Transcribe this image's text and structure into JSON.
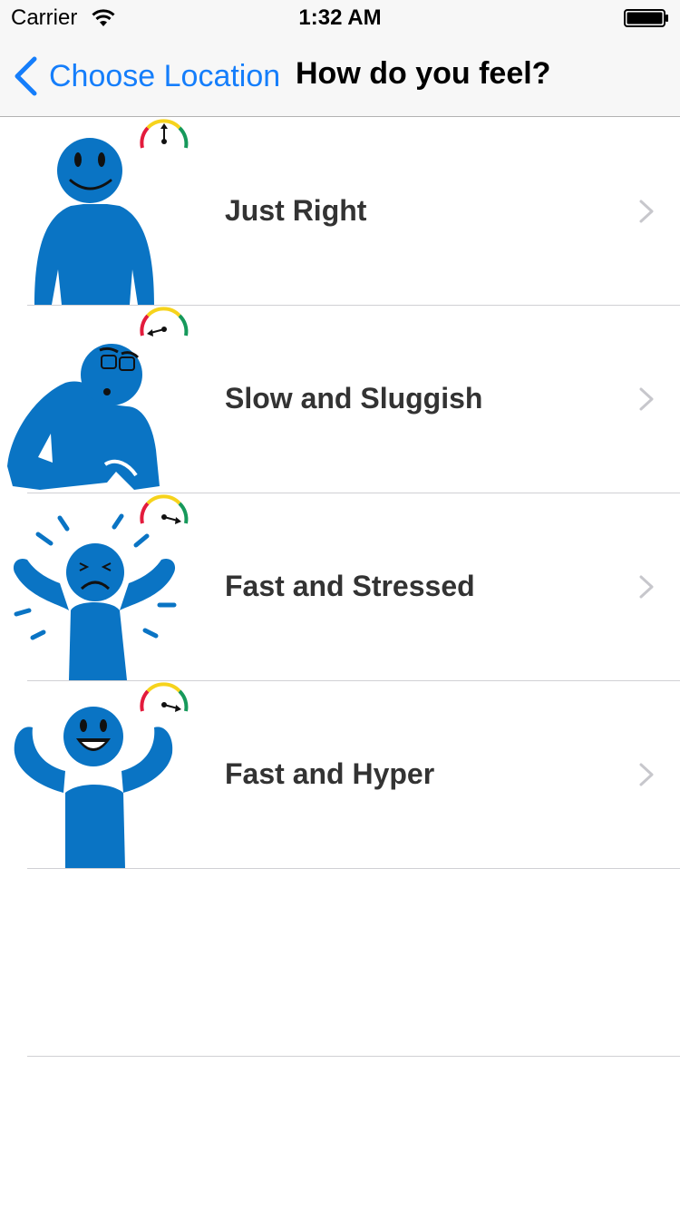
{
  "status_bar": {
    "carrier": "Carrier",
    "time": "1:32 AM",
    "wifi_icon": "wifi-icon",
    "battery_icon": "battery-full-icon"
  },
  "nav": {
    "back_label": "Choose Location",
    "back_icon": "chevron-left-icon",
    "title": "How do you feel?"
  },
  "colors": {
    "accent": "#157efb",
    "figure_blue": "#0a74c4",
    "label_text": "#333333",
    "gauge_red": "#e31b3c",
    "gauge_yellow": "#f6d31c",
    "gauge_green": "#16995b"
  },
  "feelings": [
    {
      "label": "Just Right",
      "figure_icon": "content-person-icon",
      "gauge_icon": "speed-gauge-middle-icon"
    },
    {
      "label": "Slow and Sluggish",
      "figure_icon": "tired-person-icon",
      "gauge_icon": "speed-gauge-slow-icon"
    },
    {
      "label": "Fast and Stressed",
      "figure_icon": "stressed-person-icon",
      "gauge_icon": "speed-gauge-fast-icon"
    },
    {
      "label": "Fast and Hyper",
      "figure_icon": "hyper-person-icon",
      "gauge_icon": "speed-gauge-fast-icon"
    }
  ]
}
